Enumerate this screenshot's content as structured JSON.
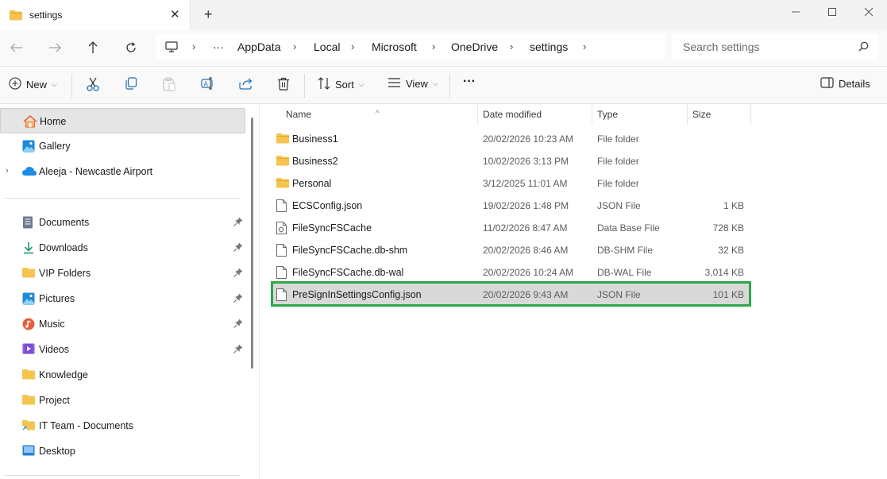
{
  "window": {
    "tab_title": "settings",
    "close_tab_glyph": "✕",
    "new_tab_glyph": "+",
    "minimize_glyph": "—",
    "maximize_glyph": "☐",
    "close_glyph": "✕"
  },
  "address": {
    "more_glyph": "···",
    "crumbs": [
      "AppData",
      "Local",
      "Microsoft",
      "OneDrive",
      "settings"
    ],
    "chevron": "›"
  },
  "search": {
    "placeholder": "Search settings"
  },
  "commands": {
    "new": "New",
    "sort": "Sort",
    "view": "View",
    "more": "···",
    "details": "Details"
  },
  "sidebar": {
    "pinned": [
      {
        "label": "Home",
        "icon": "home-icon",
        "selected": true
      },
      {
        "label": "Gallery",
        "icon": "gallery-icon"
      },
      {
        "label": "Aleeja - Newcastle Airport",
        "icon": "onedrive-cloud-icon",
        "expandable": true
      }
    ],
    "quick": [
      {
        "label": "Documents",
        "icon": "documents-icon",
        "pinned": true
      },
      {
        "label": "Downloads",
        "icon": "downloads-icon",
        "pinned": true
      },
      {
        "label": "VIP Folders",
        "icon": "folder-icon",
        "pinned": true
      },
      {
        "label": "Pictures",
        "icon": "pictures-icon",
        "pinned": true
      },
      {
        "label": "Music",
        "icon": "music-icon",
        "pinned": true
      },
      {
        "label": "Videos",
        "icon": "videos-icon",
        "pinned": true
      },
      {
        "label": "Knowledge",
        "icon": "folder-icon"
      },
      {
        "label": "Project",
        "icon": "folder-icon"
      },
      {
        "label": "IT Team - Documents",
        "icon": "shared-folder-icon"
      },
      {
        "label": "Desktop",
        "icon": "desktop-icon"
      }
    ]
  },
  "columns": {
    "name": "Name",
    "date": "Date modified",
    "type": "Type",
    "size": "Size"
  },
  "files": [
    {
      "name": "Business1",
      "date": "20/02/2026 10:23 AM",
      "type": "File folder",
      "size": "",
      "icon": "folder-icon"
    },
    {
      "name": "Business2",
      "date": "10/02/2026 3:13 PM",
      "type": "File folder",
      "size": "",
      "icon": "folder-icon"
    },
    {
      "name": "Personal",
      "date": "3/12/2025 11:01 AM",
      "type": "File folder",
      "size": "",
      "icon": "folder-icon"
    },
    {
      "name": "ECSConfig.json",
      "date": "19/02/2026 1:48 PM",
      "type": "JSON File",
      "size": "1 KB",
      "icon": "file-icon"
    },
    {
      "name": "FileSyncFSCache",
      "date": "11/02/2026 8:47 AM",
      "type": "Data Base File",
      "size": "728 KB",
      "icon": "database-file-icon"
    },
    {
      "name": "FileSyncFSCache.db-shm",
      "date": "20/02/2026 8:46 AM",
      "type": "DB-SHM File",
      "size": "32 KB",
      "icon": "file-icon"
    },
    {
      "name": "FileSyncFSCache.db-wal",
      "date": "20/02/2026 10:24 AM",
      "type": "DB-WAL File",
      "size": "3,014 KB",
      "icon": "file-icon"
    },
    {
      "name": "PreSignInSettingsConfig.json",
      "date": "20/02/2026 9:43 AM",
      "type": "JSON File",
      "size": "101 KB",
      "icon": "file-icon",
      "highlighted": true
    }
  ],
  "colors": {
    "highlight_border": "#2ea84a",
    "folder": "#f4c44e",
    "onedrive": "#1c8ce6"
  }
}
